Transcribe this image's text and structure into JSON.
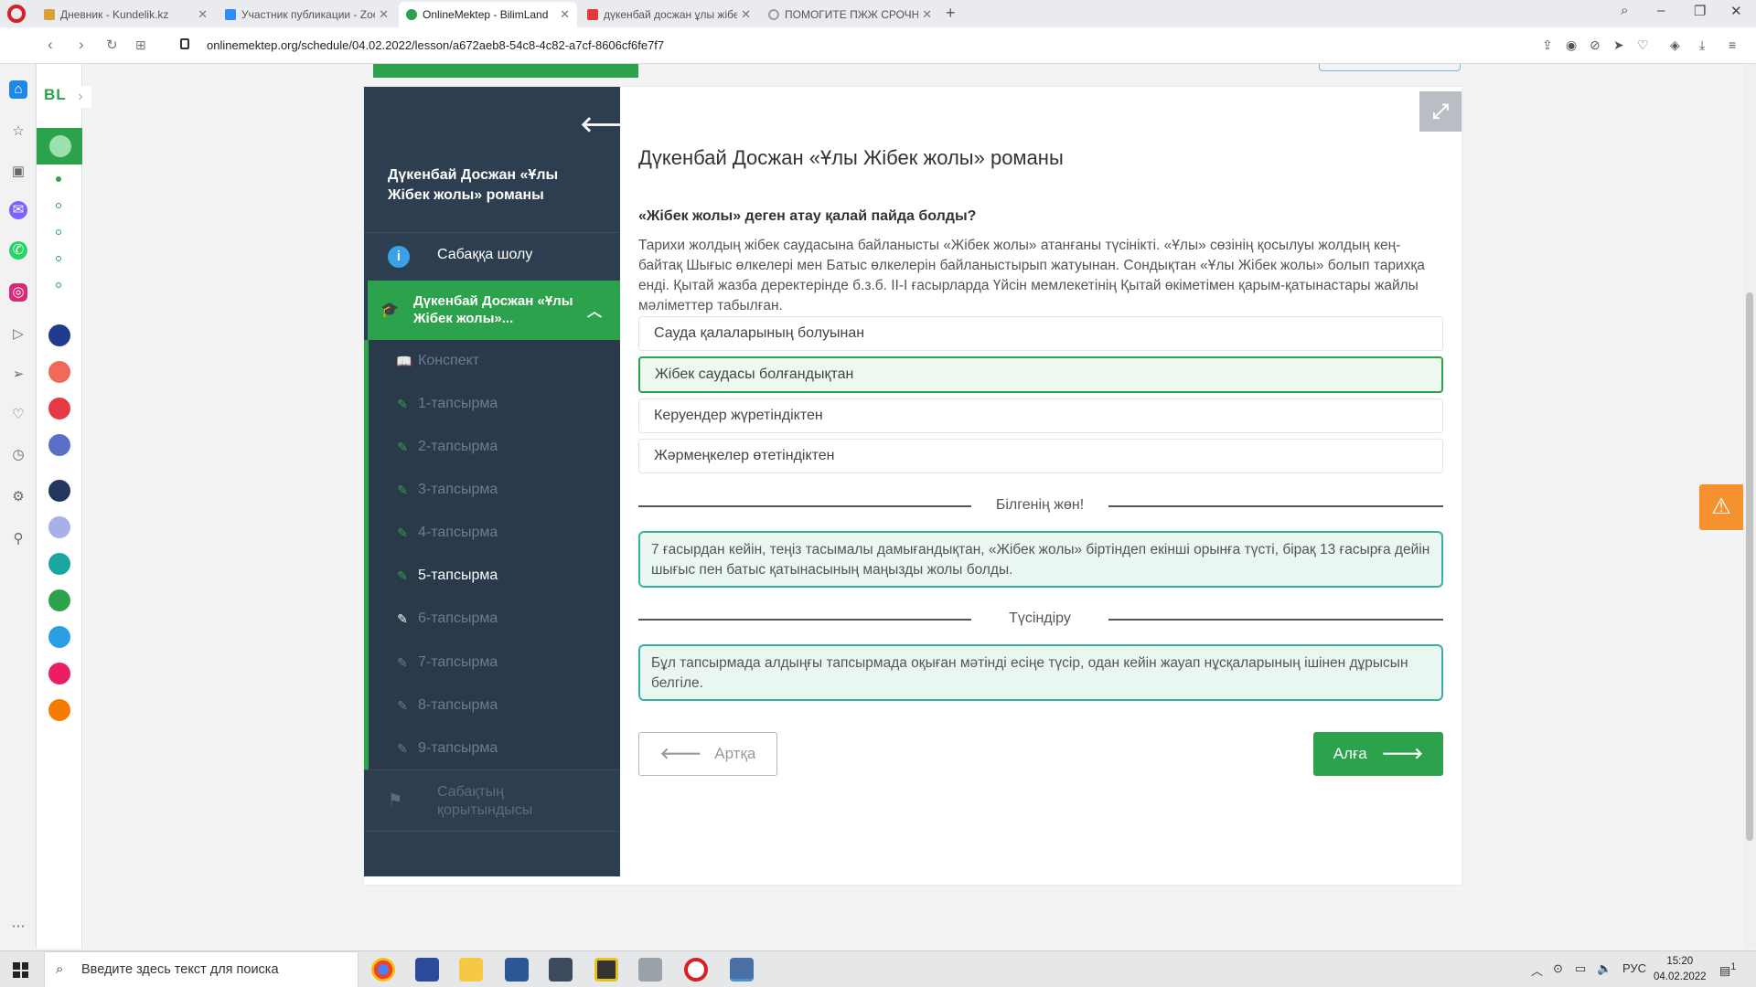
{
  "browser": {
    "tabs": [
      {
        "label": "Дневник - Kundelik.kz",
        "favicon_color": "#d8a23a",
        "active": false
      },
      {
        "label": "Участник публикации - Zoom",
        "favicon_color": "#2d8cff",
        "active": false
      },
      {
        "label": "OnlineMektep - BilimLand",
        "favicon_color": "#2ca24d",
        "active": true
      },
      {
        "label": "дүкенбай досжан ұлы жібек жолы",
        "favicon_color": "#e53935",
        "active": false
      },
      {
        "label": "ПОМОГИТЕ ПЖЖ СРОЧНО",
        "favicon_color": "#9e9e9e",
        "active": false
      }
    ],
    "url": "onlinemektep.org/schedule/04.02.2022/lesson/a672aeb8-54c8-4c82-a7cf-8606cf6fe7f7"
  },
  "rail": {
    "logo": "BL"
  },
  "lesson_nav": {
    "title": "Дүкенбай Досжан «Ұлы Жібек жолы» романы",
    "overview_label": "Сабаққа шолу",
    "module_label": "Дүкенбай Досжан «Ұлы Жібек жолы»...",
    "items": [
      {
        "label": "Конспект",
        "icon": "book-icon"
      },
      {
        "label": "1-тапсырма",
        "icon": "edit-icon"
      },
      {
        "label": "2-тапсырма",
        "icon": "edit-icon"
      },
      {
        "label": "3-тапсырма",
        "icon": "edit-icon"
      },
      {
        "label": "4-тапсырма",
        "icon": "edit-icon"
      },
      {
        "label": "5-тапсырма",
        "icon": "edit-icon"
      },
      {
        "label": "6-тапсырма",
        "icon": "edit-icon"
      },
      {
        "label": "7-тапсырма",
        "icon": "edit-icon"
      },
      {
        "label": "8-тапсырма",
        "icon": "edit-icon"
      },
      {
        "label": "9-тапсырма",
        "icon": "edit-icon"
      }
    ],
    "summary_label": "Сабақтың қорытындысы"
  },
  "content": {
    "title": "Дүкенбай Досжан «Ұлы Жібек жолы» романы",
    "question": "«Жібек жолы» деген атау қалай пайда болды?",
    "passage": "Тарихи жолдың жібек саудасына байланысты «Жібек жолы» атанғаны түсінікті. «Ұлы» сөзінің қосылуы жолдың кең-байтақ Шығыс өлкелері мен Батыс өлкелерін байланыстырып жатуынан. Сондықтан «Ұлы Жібек жолы» болып тарихқа енді. Қытай жазба деректерінде б.з.б. II-I ғасырларда Үйсін мемлекетінің Қытай өкіметімен қарым-қатынастары жайлы мәліметтер табылған.",
    "options": [
      {
        "label": "Сауда қалаларының болуынан",
        "selected": false
      },
      {
        "label": "Жібек саудасы болғандықтан",
        "selected": true
      },
      {
        "label": "Керуендер жүретіндіктен",
        "selected": false
      },
      {
        "label": "Жәрмеңкелер өтетіндіктен",
        "selected": false
      }
    ],
    "feedback_heading": "Білгенің жөн!",
    "feedback_text": "7 ғасырдан кейін, теңіз тасымалы дамығандықтан, «Жібек жолы» біртіндеп екінші орынға түсті, бірақ 13 ғасырға дейін шығыс пен батыс қатынасының маңызды жолы болды.",
    "explanation_heading": "Түсіндіру",
    "explanation_text": "Бұл тапсырмада алдыңғы тапсырмада оқыған мәтінді есіңе түсір, одан кейін жауап нұсқаларының ішінен дұрысын белгіле.",
    "back_label": "Артқа",
    "next_label": "Алға"
  },
  "taskbar": {
    "search_placeholder": "Введите здесь текст для поиска",
    "language": "РУС",
    "time": "15:20",
    "date": "04.02.2022",
    "notifications": "1"
  },
  "colors": {
    "accent": "#2ca24d",
    "nav_bg": "#2d3e50",
    "warning": "#f5922f",
    "feedback_border": "#36b0a0"
  }
}
